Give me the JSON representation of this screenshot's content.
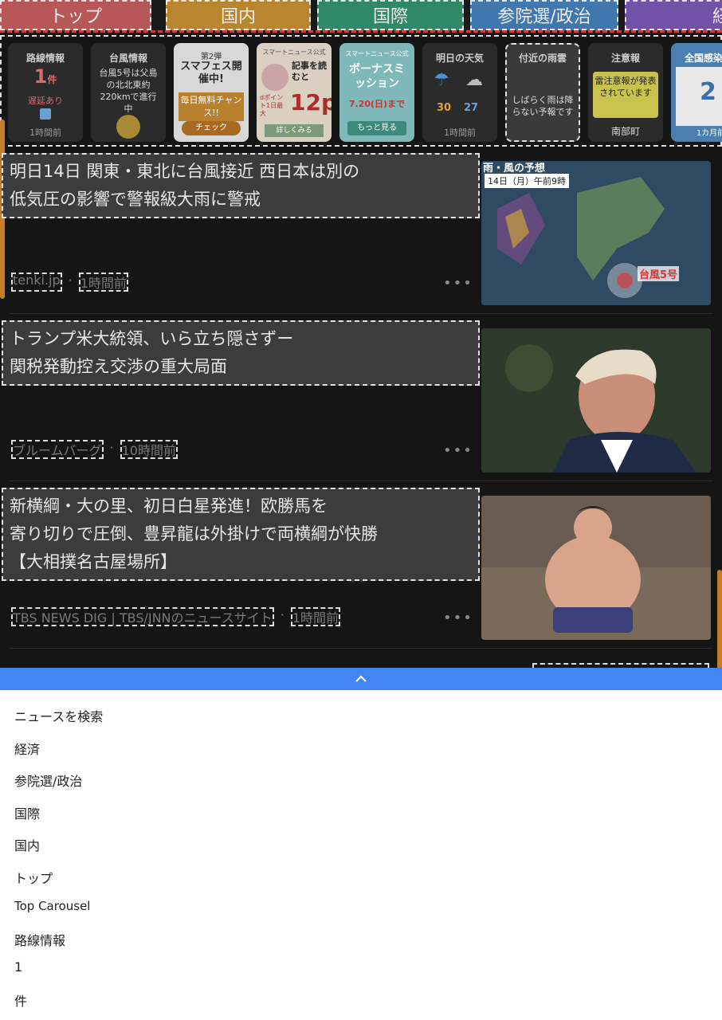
{
  "tabs": [
    {
      "label": "トップ",
      "color": "#e06a6a"
    },
    {
      "label": "国内",
      "color": "#e0a23d"
    },
    {
      "label": "国際",
      "color": "#3aa37a"
    },
    {
      "label": "参院選/政治",
      "color": "#4e8fd0"
    },
    {
      "label": "経済",
      "color": "#8a5fc7"
    }
  ],
  "carousel": {
    "train": {
      "title": "路線情報",
      "count": "1",
      "unit": "件",
      "status": "遅延あり",
      "note": "1時間前"
    },
    "typhoon": {
      "title": "台風情報",
      "text": "台風5号は父島の北北東約220kmで進行中"
    },
    "promo1": {
      "top": "第2弾",
      "main": "スマフェス開催中!",
      "sub": "毎日無料チャンス!!",
      "btn": "チェック"
    },
    "promo2": {
      "top": "スマートニュース公式",
      "main": "記事を読むと",
      "pts": "12p",
      "note": "dポイント1日最大",
      "btn": "詳しくみる"
    },
    "promo3": {
      "top": "スマートニュース公式",
      "main": "ボーナスミッション",
      "date": "7.20(日)まで",
      "btn": "もっと見る"
    },
    "weather": {
      "title": "明日の天気",
      "hi": "30",
      "lo": "27",
      "note": "1時間前"
    },
    "rain": {
      "title": "付近の雨雲",
      "text": "しばらく雨は降らない予報です"
    },
    "warning": {
      "title": "注意報",
      "text": "雷注意報が発表されています",
      "place": "南部町"
    },
    "covid": {
      "title": "全国感染者",
      "num": "2",
      "note": "1カ月前"
    }
  },
  "articles": [
    {
      "title1": "明日14日 関東・東北に台風接近 西日本は別の",
      "title2": "低気圧の影響で警報級大雨に警戒",
      "title3": "",
      "source": "tenki.jp",
      "dot": "·",
      "time": "1時間前",
      "thumb_label": "台風5号",
      "thumb_date": "14日（月）午前9時",
      "thumb_top": "雨・風の予想"
    },
    {
      "title1": "トランプ米大統領、いら立ち隠さずー",
      "title2": "関税発動控え交渉の重大局面",
      "title3": "",
      "source": "ブルームバーグ",
      "dot": "·",
      "time": "10時間前"
    },
    {
      "title1": "新横綱・大の里、初日白星発進！欧勝馬を",
      "title2": "寄り切りで圧倒、豊昇龍は外掛けで両横綱が快勝",
      "title3": "【大相撲名古屋場所】",
      "source": "TBS NEWS DIG | TBS/JNNのニュースサイト",
      "dot": "·",
      "time": "1時間前"
    }
  ],
  "more_label": "•••",
  "bluebar_icon": "chevron-up-icon",
  "panel": [
    "ニュースを検索",
    "経済",
    "参院選/政治",
    "国際",
    "国内",
    "トップ",
    "Top Carousel",
    "路線情報",
    "1",
    "件"
  ]
}
